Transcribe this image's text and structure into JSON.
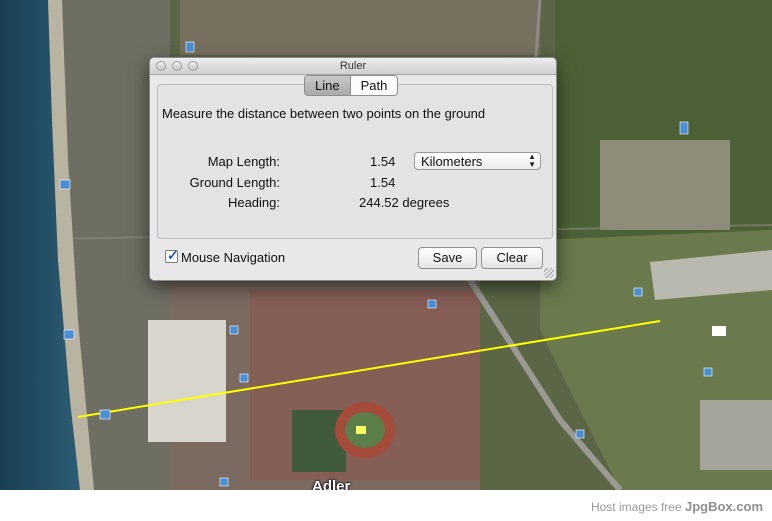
{
  "map": {
    "place_label": "Adler",
    "measure_line_color": "#ffff00",
    "sea_color": "#1f4a63",
    "runway_label_icon": "plane-icon"
  },
  "ruler": {
    "window_title": "Ruler",
    "tabs": [
      {
        "label": "Line",
        "active": true
      },
      {
        "label": "Path",
        "active": false
      }
    ],
    "instruction": "Measure the distance between two points on the ground",
    "map_length_label": "Map Length:",
    "map_length_value": "1.54",
    "unit_selected": "Kilometers",
    "ground_length_label": "Ground Length:",
    "ground_length_value": "1.54",
    "heading_label": "Heading:",
    "heading_value": "244.52 degrees",
    "mouse_navigation_label": "Mouse Navigation",
    "mouse_navigation_checked": true,
    "save_label": "Save",
    "clear_label": "Clear"
  },
  "footer": {
    "text_prefix": "Host images free",
    "brand": "JpgBox.com"
  }
}
